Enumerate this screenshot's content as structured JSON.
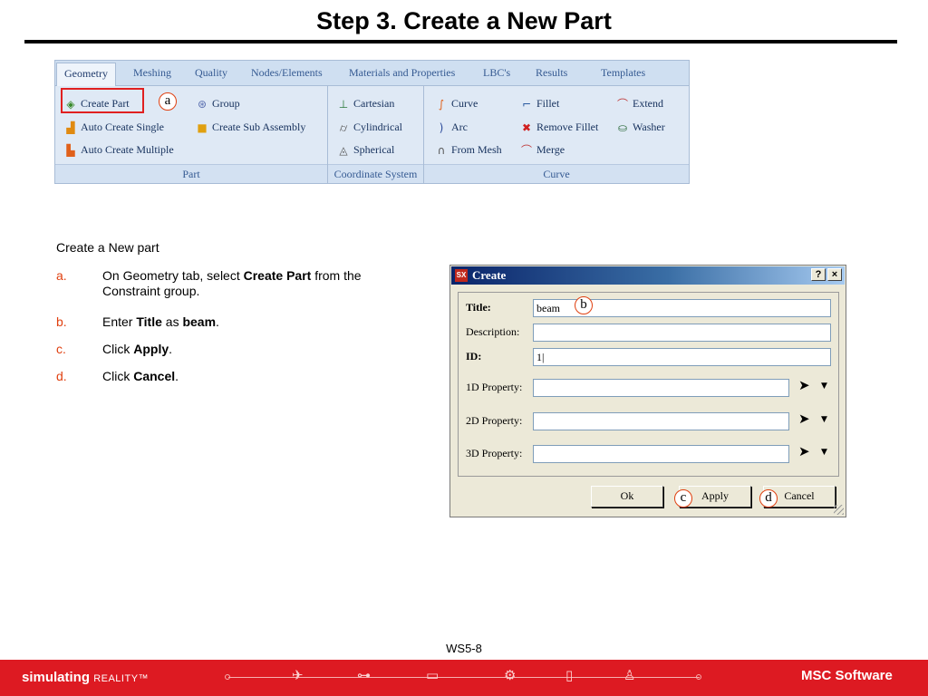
{
  "slide": {
    "title": "Step 3. Create a New Part",
    "page_number": "WS5-8"
  },
  "ribbon": {
    "tabs": [
      "Geometry",
      "Meshing",
      "Quality",
      "Nodes/Elements",
      "Materials and Properties",
      "LBC's",
      "Results",
      "Templates"
    ],
    "active_tab": "Geometry",
    "part_group": {
      "label": "Part",
      "items": [
        "Create Part",
        "Auto Create Single",
        "Auto Create Multiple",
        "Group",
        "Create Sub Assembly"
      ]
    },
    "coord_group": {
      "label": "Coordinate System",
      "items": [
        "Cartesian",
        "Cylindrical",
        "Spherical"
      ]
    },
    "curve_group": {
      "label": "Curve",
      "items": [
        "Curve",
        "Arc",
        "From Mesh",
        "Fillet",
        "Remove Fillet",
        "Merge",
        "Extend",
        "Washer"
      ]
    }
  },
  "callouts": {
    "a": "a",
    "b": "b",
    "c": "c",
    "d": "d"
  },
  "instructions": {
    "heading": "Create a New part",
    "steps": [
      {
        "letter": "a.",
        "pre": "On Geometry tab, select ",
        "bold": "Create Part",
        "post": " from the Constraint group.",
        "bold2": "",
        "post2": ""
      },
      {
        "letter": "b.",
        "pre": "Enter ",
        "bold": "Title",
        "post": " as ",
        "bold2": "beam",
        "post2": "."
      },
      {
        "letter": "c.",
        "pre": "Click ",
        "bold": "Apply",
        "post": ".",
        "bold2": "",
        "post2": ""
      },
      {
        "letter": "d.",
        "pre": "Click ",
        "bold": "Cancel",
        "post": ".",
        "bold2": "",
        "post2": ""
      }
    ]
  },
  "dialog": {
    "app_icon": "SX",
    "title": "Create",
    "help": "?",
    "close": "×",
    "fields": {
      "title": {
        "label": "Title:",
        "value": "beam"
      },
      "description": {
        "label": "Description:",
        "value": ""
      },
      "id": {
        "label": "ID:",
        "value": "1|"
      },
      "prop1d": {
        "label": "1D Property:",
        "value": ""
      },
      "prop2d": {
        "label": "2D Property:",
        "value": ""
      },
      "prop3d": {
        "label": "3D Property:",
        "value": ""
      }
    },
    "buttons": {
      "ok": "Ok",
      "apply": "Apply",
      "cancel": "Cancel"
    }
  },
  "footer": {
    "brand": "simulating",
    "brand_sub": "REALITY™",
    "logo": "MSC Software",
    "logo_mark": "╳"
  }
}
